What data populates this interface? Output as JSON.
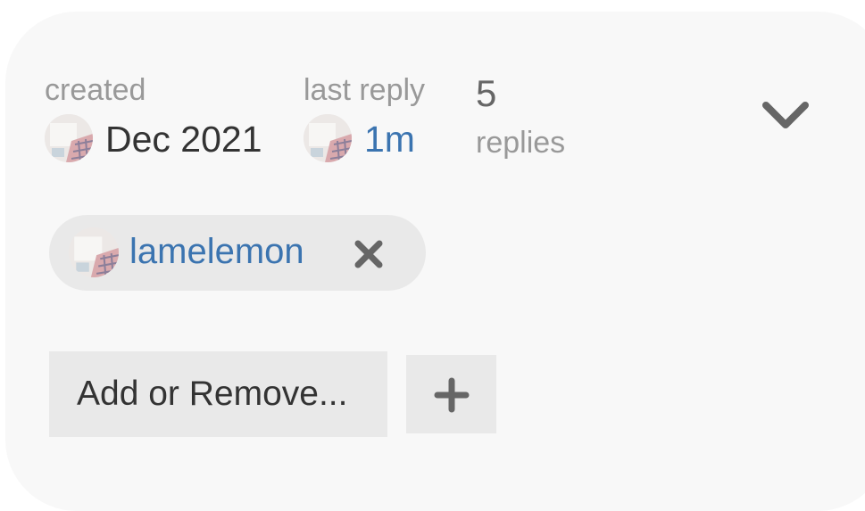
{
  "topic_meta": {
    "created": {
      "label": "created",
      "value": "Dec 2021"
    },
    "last_reply": {
      "label": "last reply",
      "value": "1m"
    },
    "replies": {
      "count": "5",
      "label": "replies"
    },
    "expand_icon": "chevron-down-icon"
  },
  "participants": [
    {
      "username": "lamelemon",
      "remove_icon": "close-icon"
    }
  ],
  "actions": {
    "add_remove_label": "Add or Remove...",
    "add_icon": "plus-icon"
  },
  "colors": {
    "card_background": "#f8f8f8",
    "chip_background": "#e9e9e9",
    "link": "#3b74b0",
    "muted_text": "#999999",
    "primary_text": "#333333",
    "icon": "#666666"
  }
}
